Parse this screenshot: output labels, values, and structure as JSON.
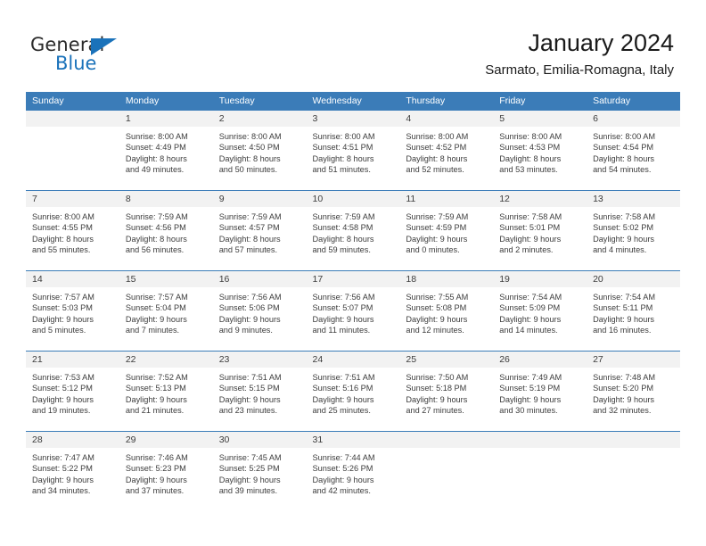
{
  "brand": {
    "name_part1": "General",
    "name_part2": "Blue",
    "color_primary": "#1a72ba",
    "color_text": "#2b2b2b"
  },
  "header": {
    "title": "January 2024",
    "subtitle": "Sarmato, Emilia-Romagna, Italy"
  },
  "calendar": {
    "header_bg": "#3b7cb8",
    "daynum_bg": "#f2f2f2",
    "weekdays": [
      "Sunday",
      "Monday",
      "Tuesday",
      "Wednesday",
      "Thursday",
      "Friday",
      "Saturday"
    ],
    "weeks": [
      [
        {
          "day": "",
          "empty": true
        },
        {
          "day": "1",
          "sunrise": "Sunrise: 8:00 AM",
          "sunset": "Sunset: 4:49 PM",
          "daylight1": "Daylight: 8 hours",
          "daylight2": "and 49 minutes."
        },
        {
          "day": "2",
          "sunrise": "Sunrise: 8:00 AM",
          "sunset": "Sunset: 4:50 PM",
          "daylight1": "Daylight: 8 hours",
          "daylight2": "and 50 minutes."
        },
        {
          "day": "3",
          "sunrise": "Sunrise: 8:00 AM",
          "sunset": "Sunset: 4:51 PM",
          "daylight1": "Daylight: 8 hours",
          "daylight2": "and 51 minutes."
        },
        {
          "day": "4",
          "sunrise": "Sunrise: 8:00 AM",
          "sunset": "Sunset: 4:52 PM",
          "daylight1": "Daylight: 8 hours",
          "daylight2": "and 52 minutes."
        },
        {
          "day": "5",
          "sunrise": "Sunrise: 8:00 AM",
          "sunset": "Sunset: 4:53 PM",
          "daylight1": "Daylight: 8 hours",
          "daylight2": "and 53 minutes."
        },
        {
          "day": "6",
          "sunrise": "Sunrise: 8:00 AM",
          "sunset": "Sunset: 4:54 PM",
          "daylight1": "Daylight: 8 hours",
          "daylight2": "and 54 minutes."
        }
      ],
      [
        {
          "day": "7",
          "sunrise": "Sunrise: 8:00 AM",
          "sunset": "Sunset: 4:55 PM",
          "daylight1": "Daylight: 8 hours",
          "daylight2": "and 55 minutes."
        },
        {
          "day": "8",
          "sunrise": "Sunrise: 7:59 AM",
          "sunset": "Sunset: 4:56 PM",
          "daylight1": "Daylight: 8 hours",
          "daylight2": "and 56 minutes."
        },
        {
          "day": "9",
          "sunrise": "Sunrise: 7:59 AM",
          "sunset": "Sunset: 4:57 PM",
          "daylight1": "Daylight: 8 hours",
          "daylight2": "and 57 minutes."
        },
        {
          "day": "10",
          "sunrise": "Sunrise: 7:59 AM",
          "sunset": "Sunset: 4:58 PM",
          "daylight1": "Daylight: 8 hours",
          "daylight2": "and 59 minutes."
        },
        {
          "day": "11",
          "sunrise": "Sunrise: 7:59 AM",
          "sunset": "Sunset: 4:59 PM",
          "daylight1": "Daylight: 9 hours",
          "daylight2": "and 0 minutes."
        },
        {
          "day": "12",
          "sunrise": "Sunrise: 7:58 AM",
          "sunset": "Sunset: 5:01 PM",
          "daylight1": "Daylight: 9 hours",
          "daylight2": "and 2 minutes."
        },
        {
          "day": "13",
          "sunrise": "Sunrise: 7:58 AM",
          "sunset": "Sunset: 5:02 PM",
          "daylight1": "Daylight: 9 hours",
          "daylight2": "and 4 minutes."
        }
      ],
      [
        {
          "day": "14",
          "sunrise": "Sunrise: 7:57 AM",
          "sunset": "Sunset: 5:03 PM",
          "daylight1": "Daylight: 9 hours",
          "daylight2": "and 5 minutes."
        },
        {
          "day": "15",
          "sunrise": "Sunrise: 7:57 AM",
          "sunset": "Sunset: 5:04 PM",
          "daylight1": "Daylight: 9 hours",
          "daylight2": "and 7 minutes."
        },
        {
          "day": "16",
          "sunrise": "Sunrise: 7:56 AM",
          "sunset": "Sunset: 5:06 PM",
          "daylight1": "Daylight: 9 hours",
          "daylight2": "and 9 minutes."
        },
        {
          "day": "17",
          "sunrise": "Sunrise: 7:56 AM",
          "sunset": "Sunset: 5:07 PM",
          "daylight1": "Daylight: 9 hours",
          "daylight2": "and 11 minutes."
        },
        {
          "day": "18",
          "sunrise": "Sunrise: 7:55 AM",
          "sunset": "Sunset: 5:08 PM",
          "daylight1": "Daylight: 9 hours",
          "daylight2": "and 12 minutes."
        },
        {
          "day": "19",
          "sunrise": "Sunrise: 7:54 AM",
          "sunset": "Sunset: 5:09 PM",
          "daylight1": "Daylight: 9 hours",
          "daylight2": "and 14 minutes."
        },
        {
          "day": "20",
          "sunrise": "Sunrise: 7:54 AM",
          "sunset": "Sunset: 5:11 PM",
          "daylight1": "Daylight: 9 hours",
          "daylight2": "and 16 minutes."
        }
      ],
      [
        {
          "day": "21",
          "sunrise": "Sunrise: 7:53 AM",
          "sunset": "Sunset: 5:12 PM",
          "daylight1": "Daylight: 9 hours",
          "daylight2": "and 19 minutes."
        },
        {
          "day": "22",
          "sunrise": "Sunrise: 7:52 AM",
          "sunset": "Sunset: 5:13 PM",
          "daylight1": "Daylight: 9 hours",
          "daylight2": "and 21 minutes."
        },
        {
          "day": "23",
          "sunrise": "Sunrise: 7:51 AM",
          "sunset": "Sunset: 5:15 PM",
          "daylight1": "Daylight: 9 hours",
          "daylight2": "and 23 minutes."
        },
        {
          "day": "24",
          "sunrise": "Sunrise: 7:51 AM",
          "sunset": "Sunset: 5:16 PM",
          "daylight1": "Daylight: 9 hours",
          "daylight2": "and 25 minutes."
        },
        {
          "day": "25",
          "sunrise": "Sunrise: 7:50 AM",
          "sunset": "Sunset: 5:18 PM",
          "daylight1": "Daylight: 9 hours",
          "daylight2": "and 27 minutes."
        },
        {
          "day": "26",
          "sunrise": "Sunrise: 7:49 AM",
          "sunset": "Sunset: 5:19 PM",
          "daylight1": "Daylight: 9 hours",
          "daylight2": "and 30 minutes."
        },
        {
          "day": "27",
          "sunrise": "Sunrise: 7:48 AM",
          "sunset": "Sunset: 5:20 PM",
          "daylight1": "Daylight: 9 hours",
          "daylight2": "and 32 minutes."
        }
      ],
      [
        {
          "day": "28",
          "sunrise": "Sunrise: 7:47 AM",
          "sunset": "Sunset: 5:22 PM",
          "daylight1": "Daylight: 9 hours",
          "daylight2": "and 34 minutes."
        },
        {
          "day": "29",
          "sunrise": "Sunrise: 7:46 AM",
          "sunset": "Sunset: 5:23 PM",
          "daylight1": "Daylight: 9 hours",
          "daylight2": "and 37 minutes."
        },
        {
          "day": "30",
          "sunrise": "Sunrise: 7:45 AM",
          "sunset": "Sunset: 5:25 PM",
          "daylight1": "Daylight: 9 hours",
          "daylight2": "and 39 minutes."
        },
        {
          "day": "31",
          "sunrise": "Sunrise: 7:44 AM",
          "sunset": "Sunset: 5:26 PM",
          "daylight1": "Daylight: 9 hours",
          "daylight2": "and 42 minutes."
        },
        {
          "day": "",
          "empty": true
        },
        {
          "day": "",
          "empty": true
        },
        {
          "day": "",
          "empty": true
        }
      ]
    ]
  }
}
